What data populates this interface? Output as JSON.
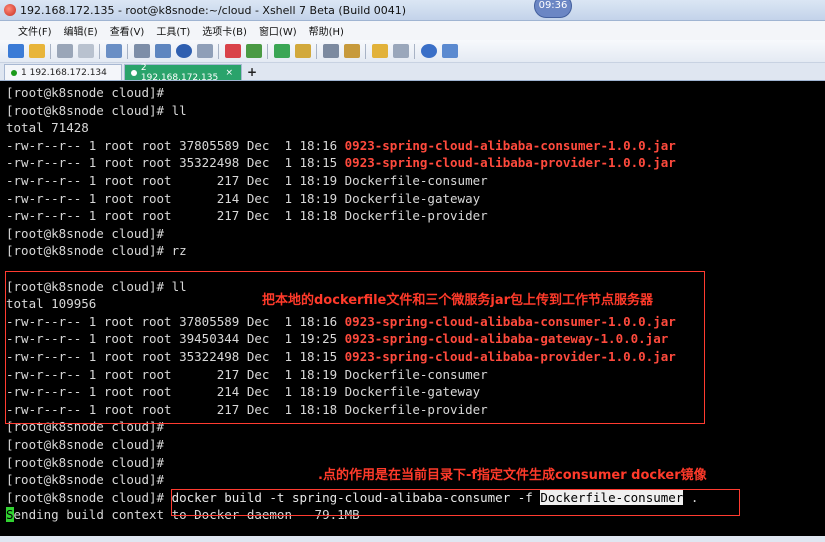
{
  "window": {
    "title": "192.168.172.135 - root@k8snode:~/cloud - Xshell 7 Beta (Build 0041)",
    "clock": "09:36"
  },
  "menu": [
    "文件(F)",
    "编辑(E)",
    "查看(V)",
    "工具(T)",
    "选项卡(B)",
    "窗口(W)",
    "帮助(H)"
  ],
  "tabs": [
    {
      "label": "1 192.168.172.134",
      "active": false
    },
    {
      "label": "2 192.168.172.135",
      "active": true
    }
  ],
  "terminal": {
    "lines": [
      {
        "text": "[root@k8snode cloud]#"
      },
      {
        "text": "[root@k8snode cloud]# ll"
      },
      {
        "text": "total 71428"
      },
      {
        "text": "-rw-r--r-- 1 root root 37805589 Dec  1 18:16 ",
        "jar": "0923-spring-cloud-alibaba-consumer-1.0.0.jar"
      },
      {
        "text": "-rw-r--r-- 1 root root 35322498 Dec  1 18:15 ",
        "jar": "0923-spring-cloud-alibaba-provider-1.0.0.jar"
      },
      {
        "text": "-rw-r--r-- 1 root root      217 Dec  1 18:19 Dockerfile-consumer"
      },
      {
        "text": "-rw-r--r-- 1 root root      214 Dec  1 18:19 Dockerfile-gateway"
      },
      {
        "text": "-rw-r--r-- 1 root root      217 Dec  1 18:18 Dockerfile-provider"
      },
      {
        "text": "[root@k8snode cloud]#"
      },
      {
        "text": "[root@k8snode cloud]# rz"
      },
      {
        "text": ""
      },
      {
        "text": "[root@k8snode cloud]# ll"
      },
      {
        "text": "total 109956"
      },
      {
        "text": "-rw-r--r-- 1 root root 37805589 Dec  1 18:16 ",
        "jar": "0923-spring-cloud-alibaba-consumer-1.0.0.jar"
      },
      {
        "text": "-rw-r--r-- 1 root root 39450344 Dec  1 19:25 ",
        "jar": "0923-spring-cloud-alibaba-gateway-1.0.0.jar"
      },
      {
        "text": "-rw-r--r-- 1 root root 35322498 Dec  1 18:15 ",
        "jar": "0923-spring-cloud-alibaba-provider-1.0.0.jar"
      },
      {
        "text": "-rw-r--r-- 1 root root      217 Dec  1 18:19 Dockerfile-consumer"
      },
      {
        "text": "-rw-r--r-- 1 root root      214 Dec  1 18:19 Dockerfile-gateway"
      },
      {
        "text": "-rw-r--r-- 1 root root      217 Dec  1 18:18 Dockerfile-provider"
      },
      {
        "text": "[root@k8snode cloud]#"
      },
      {
        "text": "[root@k8snode cloud]#"
      },
      {
        "text": "[root@k8snode cloud]#"
      },
      {
        "text": "[root@k8snode cloud]#"
      },
      {
        "text": "[root@k8snode cloud]# ",
        "cmd": "docker build -t spring-cloud-alibaba-consumer -f ",
        "sel": "Dockerfile-consumer",
        "tail": " ."
      },
      {
        "cursor": "S",
        "text": "ending build context to Docker daemon   79.1MB"
      }
    ],
    "annotations": {
      "upload": "把本地的dockerfile文件和三个微服务jar包上传到工作节点服务器",
      "dot": ".点的作用是在当前目录下-f指定文件生成consumer docker镜像"
    }
  },
  "colors": {
    "jar_text": "#ff4a3d",
    "annotation": "#ff3a2a",
    "active_tab": "#2aa36b",
    "cursor": "#31d231"
  }
}
